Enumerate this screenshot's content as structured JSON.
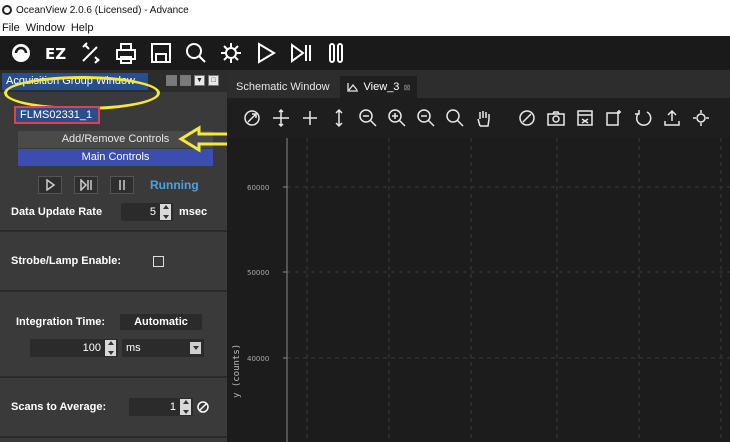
{
  "window": {
    "title": "OceanView 2.0.6 (Licensed) - Advance"
  },
  "menu": {
    "items": [
      {
        "label": "File",
        "accel": "F"
      },
      {
        "label": "Window",
        "accel": "W"
      },
      {
        "label": "Help",
        "accel": "H"
      }
    ]
  },
  "toolbar": {
    "icons": [
      "oceanview-logo-icon",
      "ez-wizard-icon",
      "tools-icon",
      "print-icon",
      "save-icon",
      "zoom-icon",
      "settings-icon",
      "play-icon",
      "play-once-icon",
      "pause-icon"
    ]
  },
  "left_panel": {
    "title": "Acquisition Group Window",
    "device_tab": "FLMS02331_1",
    "add_remove": "Add/Remove Controls",
    "main_controls": "Main Controls",
    "status": "Running",
    "data_update_rate": {
      "label": "Data Update Rate",
      "value": "5",
      "unit": "msec"
    },
    "strobe": {
      "label": "Strobe/Lamp Enable:"
    },
    "integration": {
      "label": "Integration Time:",
      "mode": "Automatic",
      "value": "100",
      "unit": "ms"
    },
    "scans": {
      "label": "Scans to Average:",
      "value": "1"
    }
  },
  "tabs": [
    {
      "label": "Schematic Window",
      "active": false
    },
    {
      "label": "View_3",
      "active": true,
      "close": "⊠"
    }
  ],
  "graph_toolbar": {
    "icons": [
      "auto-scale-icon",
      "pan-icon",
      "move-icon",
      "vertical-scale-icon",
      "zoom-region-icon",
      "zoom-in-icon",
      "zoom-out-icon",
      "zoom-icon",
      "hand-icon",
      "auto-scale-once-icon",
      "camera-icon",
      "export-icon",
      "peak-icon",
      "undo-icon",
      "upload-icon",
      "settings-icon"
    ]
  },
  "plot": {
    "y_ticks": [
      "60000",
      "50000",
      "40000"
    ],
    "ylabel": "y (counts)"
  },
  "colors": {
    "accent_blue": "#2a4e8c",
    "main_controls_blue": "#3b4db0",
    "running_blue": "#4aa3e0",
    "annotation_yellow": "#f4e93a"
  }
}
